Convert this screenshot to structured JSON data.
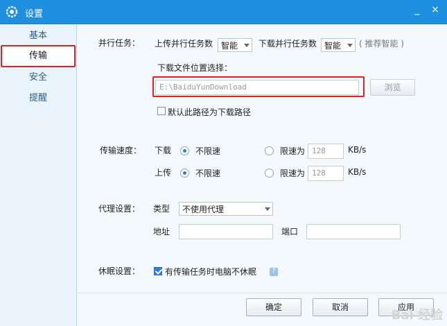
{
  "window": {
    "title": "设置",
    "minimize": "_",
    "close": "×"
  },
  "sidebar": {
    "items": [
      {
        "label": "基本"
      },
      {
        "label": "传输"
      },
      {
        "label": "安全"
      },
      {
        "label": "提醒"
      }
    ]
  },
  "parallel": {
    "label": "并行任务：",
    "upload_label": "上传并行任务数",
    "upload_value": "智能",
    "download_label": "下载并行任务数",
    "download_value": "智能",
    "hint": "( 推荐智能 )"
  },
  "download_location": {
    "label": "下载文件位置选择：",
    "path": "E:\\BaiduYunDownload",
    "browse": "浏览",
    "default_checkbox": "默认此路径为下载路径"
  },
  "speed": {
    "label": "传输速度：",
    "download_label": "下载",
    "upload_label": "上传",
    "unlimited": "不限速",
    "limit": "限速为",
    "download_limit": "128",
    "upload_limit": "128",
    "unit": "KB/s"
  },
  "proxy": {
    "label": "代理设置：",
    "type_label": "类型",
    "type_value": "不使用代理",
    "address_label": "地址",
    "port_label": "端口"
  },
  "sleep": {
    "label": "休眠设置：",
    "checkbox": "有传输任务时电脑不休眠",
    "help": "?"
  },
  "buttons": {
    "ok": "确定",
    "cancel": "取消",
    "apply": "应用"
  },
  "watermark": "Bai 经验"
}
